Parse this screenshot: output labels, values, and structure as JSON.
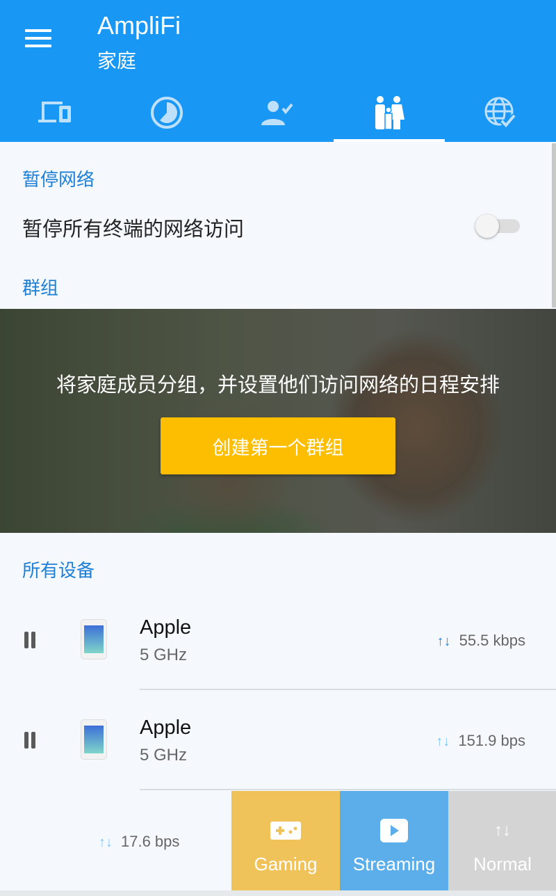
{
  "header": {
    "title": "AmpliFi",
    "subtitle": "家庭",
    "menu_icon": "hamburger-menu-icon",
    "tabs": [
      {
        "icon": "devices-icon"
      },
      {
        "icon": "usage-clock-icon"
      },
      {
        "icon": "user-check-icon"
      },
      {
        "icon": "family-icon",
        "active": true
      },
      {
        "icon": "internet-check-icon"
      }
    ]
  },
  "pause_network": {
    "section": "暂停网络",
    "label": "暂停所有终端的网络访问",
    "enabled": false
  },
  "groups": {
    "section": "群组",
    "banner_text": "将家庭成员分组，并设置他们访问网络的日程安排",
    "button": "创建第一个群组"
  },
  "devices": {
    "section": "所有设备",
    "items": [
      {
        "name": "Apple",
        "band": "5 GHz",
        "rate": "55.5 kbps"
      },
      {
        "name": "Apple",
        "band": "5 GHz",
        "rate": "151.9 bps"
      },
      {
        "rate": "17.6 bps"
      }
    ]
  },
  "qos": [
    {
      "label": "Gaming",
      "icon": "gamepad-icon",
      "color": "#f0c35a"
    },
    {
      "label": "Streaming",
      "icon": "play-icon",
      "color": "#5baee9"
    },
    {
      "label": "Normal",
      "icon": "up-down-arrows-icon",
      "color": "#d4d4d4"
    }
  ],
  "colors": {
    "primary": "#1997f4",
    "accent": "#fdbd00",
    "section": "#1e7fd6"
  }
}
